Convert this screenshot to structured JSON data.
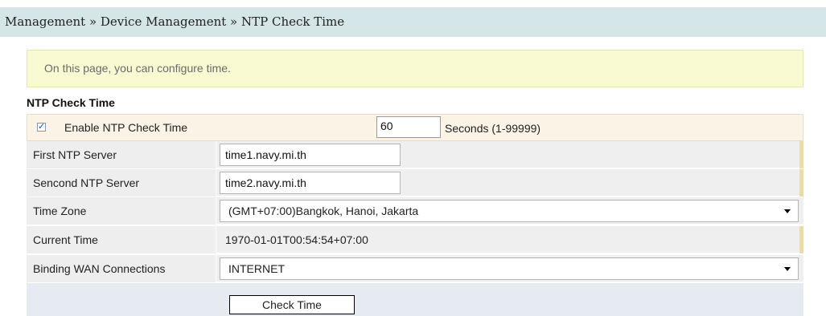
{
  "breadcrumb": "Management » Device Management » NTP Check Time",
  "info": "On this page, you can configure time.",
  "section_title": "NTP Check Time",
  "enable": {
    "checked": true,
    "label": "Enable NTP Check Time",
    "seconds_value": "60",
    "seconds_suffix": "Seconds (1-99999)"
  },
  "fields": {
    "first_server": {
      "label": "First NTP Server",
      "value": "time1.navy.mi.th"
    },
    "second_server": {
      "label": "Sencond NTP Server",
      "value": "time2.navy.mi.th"
    },
    "time_zone": {
      "label": "Time Zone",
      "value": "(GMT+07:00)Bangkok, Hanoi, Jakarta"
    },
    "current_time": {
      "label": "Current Time",
      "value": "1970-01-01T00:54:54+07:00"
    },
    "wan": {
      "label": "Binding WAN Connections",
      "value": "INTERNET"
    }
  },
  "buttons": {
    "check_time": "Check Time"
  },
  "colors": {
    "breadcrumb_bg": "#d4e6e8",
    "info_bg": "#fafad2",
    "row_bg": "#efefef",
    "accent_rail": "#ecdba8"
  }
}
